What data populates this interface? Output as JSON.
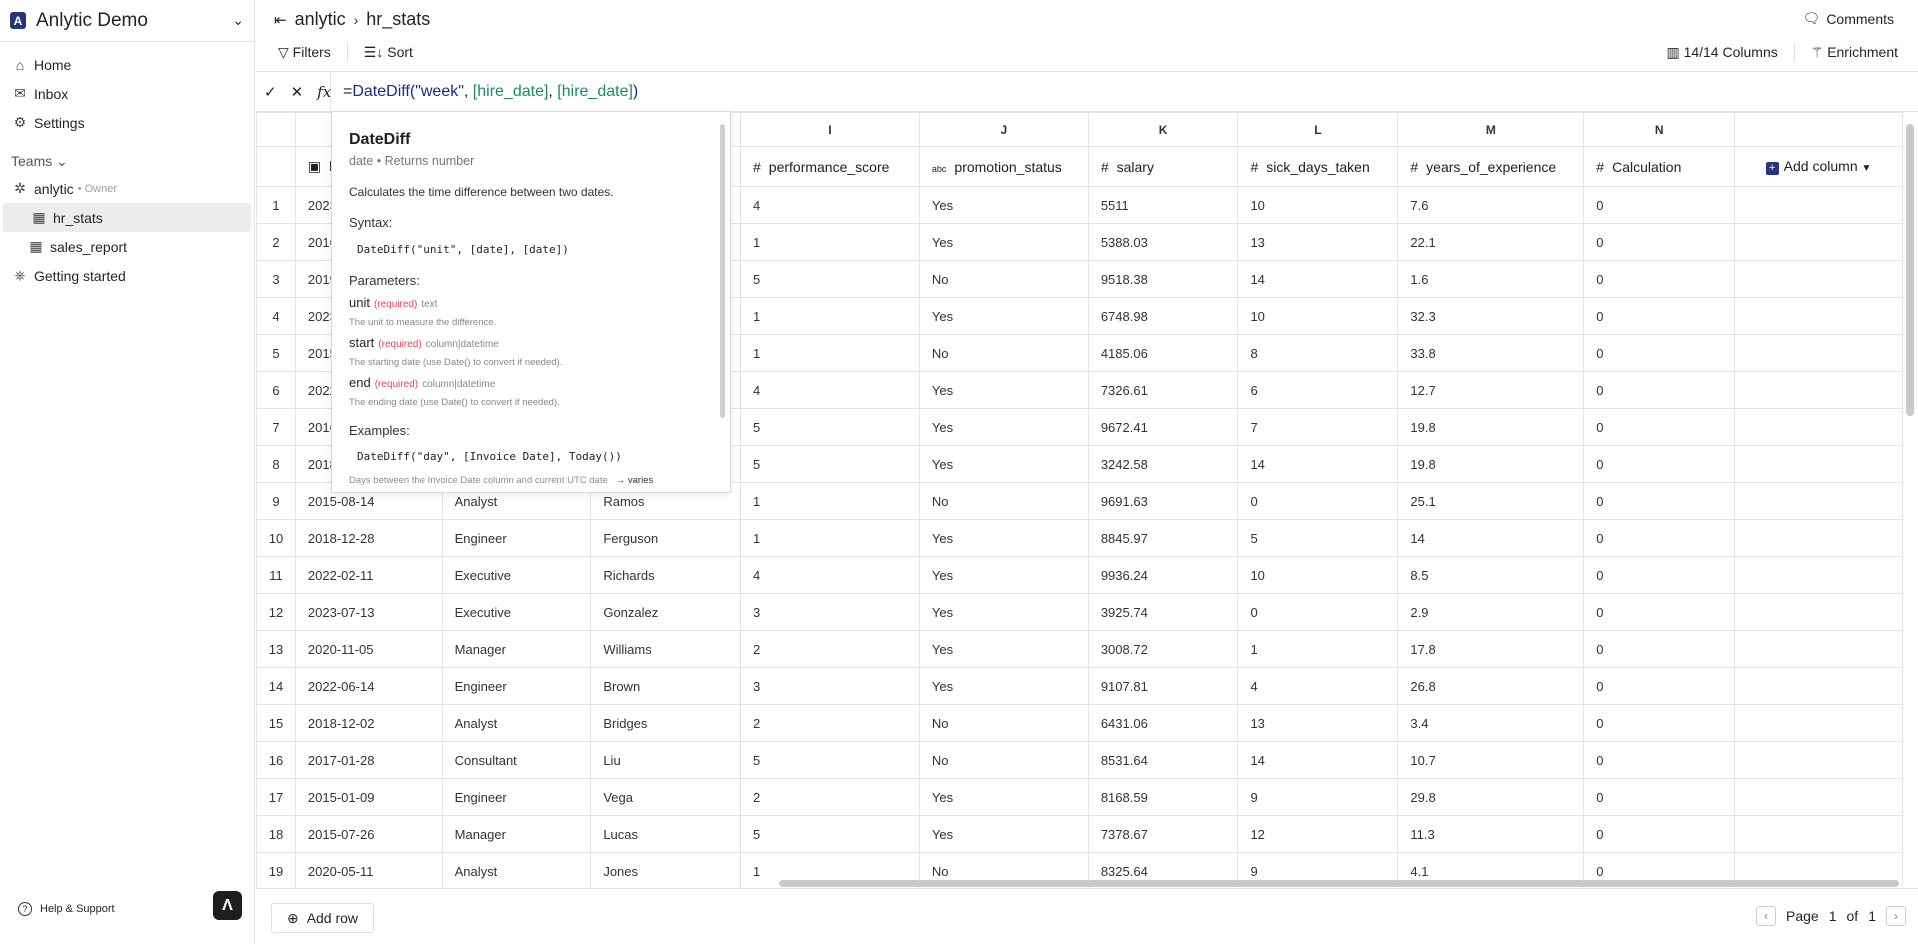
{
  "sidebar": {
    "workspace": "Anlytic Demo",
    "logo_letter": "A",
    "nav": [
      {
        "label": "Home",
        "icon": "home-icon"
      },
      {
        "label": "Inbox",
        "icon": "inbox-icon"
      },
      {
        "label": "Settings",
        "icon": "gear-icon"
      }
    ],
    "teams_label": "Teams",
    "team": {
      "name": "anlytic",
      "role": "• Owner"
    },
    "tables": [
      {
        "label": "hr_stats",
        "selected": true
      },
      {
        "label": "sales_report",
        "selected": false
      }
    ],
    "getting_started": "Getting started",
    "help": "Help & Support"
  },
  "header": {
    "breadcrumb": [
      "anlytic",
      "hr_stats"
    ],
    "filters": "Filters",
    "sort": "Sort",
    "comments": "Comments",
    "columns": "14/14 Columns",
    "enrichment": "Enrichment"
  },
  "formula": {
    "prefix": "=",
    "fn": "DateDiff(",
    "arg1": "\"week\"",
    "sep": ", ",
    "ref1": "[hire_date]",
    "sep2": ", ",
    "ref2": "[hire_date]",
    "close": ")"
  },
  "popup": {
    "title": "DateDiff",
    "meta": "date • Returns number",
    "description": "Calculates the time difference between two dates.",
    "syntax_label": "Syntax:",
    "syntax": "DateDiff(\"unit\", [date], [date])",
    "params_label": "Parameters:",
    "params": [
      {
        "name": "unit",
        "req": "(required)",
        "type": "text",
        "desc": "The unit to measure the difference."
      },
      {
        "name": "start",
        "req": "(required)",
        "type": "column|datetime",
        "desc": "The starting date (use Date() to convert if needed)."
      },
      {
        "name": "end",
        "req": "(required)",
        "type": "column|datetime",
        "desc": "The ending date (use Date() to convert if needed)."
      }
    ],
    "examples_label": "Examples:",
    "example": "DateDiff(\"day\", [Invoice Date], Today())",
    "example_desc": "Days between the Invoice Date column and current UTC date",
    "example_result": "→ varies"
  },
  "grid": {
    "letters": [
      "",
      "",
      "",
      "I",
      "J",
      "K",
      "L",
      "M",
      "N",
      ""
    ],
    "headers": [
      {
        "label": "h",
        "icon": "calendar-icon"
      },
      {
        "label": "",
        "icon": ""
      },
      {
        "label": "",
        "icon": ""
      },
      {
        "label": "performance_score",
        "icon": "#"
      },
      {
        "label": "promotion_status",
        "icon": "abc"
      },
      {
        "label": "salary",
        "icon": "#"
      },
      {
        "label": "sick_days_taken",
        "icon": "#"
      },
      {
        "label": "years_of_experience",
        "icon": "#"
      },
      {
        "label": "Calculation",
        "icon": "#"
      }
    ],
    "add_column": "Add column",
    "rows": [
      [
        "1",
        "2023",
        "",
        "",
        "4",
        "Yes",
        "5511",
        "10",
        "7.6",
        "0"
      ],
      [
        "2",
        "2016",
        "",
        "",
        "1",
        "Yes",
        "5388.03",
        "13",
        "22.1",
        "0"
      ],
      [
        "3",
        "2019",
        "",
        "",
        "5",
        "No",
        "9518.38",
        "14",
        "1.6",
        "0"
      ],
      [
        "4",
        "2023",
        "",
        "",
        "1",
        "Yes",
        "6748.98",
        "10",
        "32.3",
        "0"
      ],
      [
        "5",
        "2015",
        "",
        "",
        "1",
        "No",
        "4185.06",
        "8",
        "33.8",
        "0"
      ],
      [
        "6",
        "2022",
        "",
        "",
        "4",
        "Yes",
        "7326.61",
        "6",
        "12.7",
        "0"
      ],
      [
        "7",
        "2016",
        "",
        "",
        "5",
        "Yes",
        "9672.41",
        "7",
        "19.8",
        "0"
      ],
      [
        "8",
        "2018",
        "",
        "",
        "5",
        "Yes",
        "3242.58",
        "14",
        "19.8",
        "0"
      ],
      [
        "9",
        "2015-08-14",
        "Analyst",
        "Ramos",
        "1",
        "No",
        "9691.63",
        "0",
        "25.1",
        "0"
      ],
      [
        "10",
        "2018-12-28",
        "Engineer",
        "Ferguson",
        "1",
        "Yes",
        "8845.97",
        "5",
        "14",
        "0"
      ],
      [
        "11",
        "2022-02-11",
        "Executive",
        "Richards",
        "4",
        "Yes",
        "9936.24",
        "10",
        "8.5",
        "0"
      ],
      [
        "12",
        "2023-07-13",
        "Executive",
        "Gonzalez",
        "3",
        "Yes",
        "3925.74",
        "0",
        "2.9",
        "0"
      ],
      [
        "13",
        "2020-11-05",
        "Manager",
        "Williams",
        "2",
        "Yes",
        "3008.72",
        "1",
        "17.8",
        "0"
      ],
      [
        "14",
        "2022-06-14",
        "Engineer",
        "Brown",
        "3",
        "Yes",
        "9107.81",
        "4",
        "26.8",
        "0"
      ],
      [
        "15",
        "2018-12-02",
        "Analyst",
        "Bridges",
        "2",
        "No",
        "6431.06",
        "13",
        "3.4",
        "0"
      ],
      [
        "16",
        "2017-01-28",
        "Consultant",
        "Liu",
        "5",
        "No",
        "8531.64",
        "14",
        "10.7",
        "0"
      ],
      [
        "17",
        "2015-01-09",
        "Engineer",
        "Vega",
        "2",
        "Yes",
        "8168.59",
        "9",
        "29.8",
        "0"
      ],
      [
        "18",
        "2015-07-26",
        "Manager",
        "Lucas",
        "5",
        "Yes",
        "7378.67",
        "12",
        "11.3",
        "0"
      ],
      [
        "19",
        "2020-05-11",
        "Analyst",
        "Jones",
        "1",
        "No",
        "8325.64",
        "9",
        "4.1",
        "0"
      ]
    ]
  },
  "footer": {
    "add_row": "Add row",
    "page_label": "Page",
    "page": "1",
    "of": "of",
    "total": "1"
  },
  "colors": {
    "brand": "#27337a",
    "calc": "#1a8a5a",
    "required": "#e0445f"
  }
}
